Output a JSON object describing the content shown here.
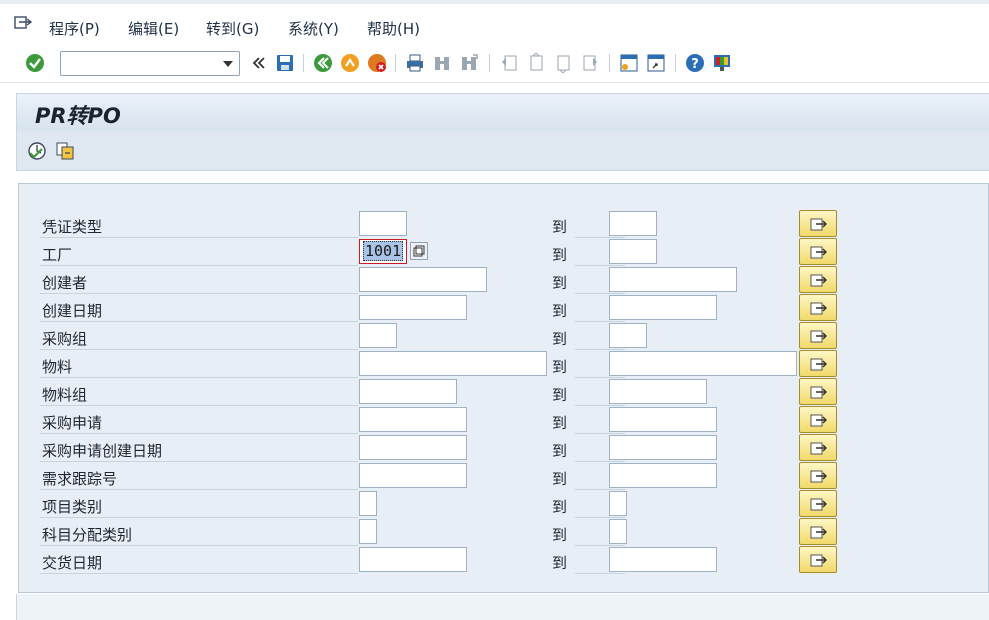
{
  "menu": {
    "items": [
      {
        "label": "程序(P)"
      },
      {
        "label": "编辑(E)"
      },
      {
        "label": "转到(G)"
      },
      {
        "label": "系统(Y)"
      },
      {
        "label": "帮助(H)"
      }
    ]
  },
  "toolbar": {
    "command_field_value": "",
    "icons": [
      "enter-icon",
      "back-double-arrow-icon",
      "save-icon",
      "back-icon",
      "exit-icon",
      "cancel-icon",
      "print-icon",
      "find-icon",
      "find-next-icon",
      "first-page-icon",
      "prev-page-icon",
      "next-page-icon",
      "last-page-icon",
      "new-session-icon",
      "shortcut-icon",
      "help-icon",
      "customize-layout-icon"
    ]
  },
  "title": "PR转PO",
  "app_toolbar": {
    "icons": [
      "execute-icon",
      "get-variant-icon"
    ]
  },
  "selection": {
    "to_label": "到",
    "rows": [
      {
        "label": "凭证类型",
        "low": "",
        "high": ""
      },
      {
        "label": "工厂",
        "low": "1001",
        "high": ""
      },
      {
        "label": "创建者",
        "low": "",
        "high": ""
      },
      {
        "label": "创建日期",
        "low": "",
        "high": ""
      },
      {
        "label": "采购组",
        "low": "",
        "high": ""
      },
      {
        "label": "物料",
        "low": "",
        "high": ""
      },
      {
        "label": "物料组",
        "low": "",
        "high": ""
      },
      {
        "label": "采购申请",
        "low": "",
        "high": ""
      },
      {
        "label": "采购申请创建日期",
        "low": "",
        "high": ""
      },
      {
        "label": "需求跟踪号",
        "low": "",
        "high": ""
      },
      {
        "label": "项目类别",
        "low": "",
        "high": ""
      },
      {
        "label": "科目分配类别",
        "low": "",
        "high": ""
      },
      {
        "label": "交货日期",
        "low": "",
        "high": ""
      }
    ]
  },
  "colors": {
    "panel_bg": "#e7eef6",
    "multi_button": "#f1d96a",
    "focus_border": "#c82020"
  }
}
